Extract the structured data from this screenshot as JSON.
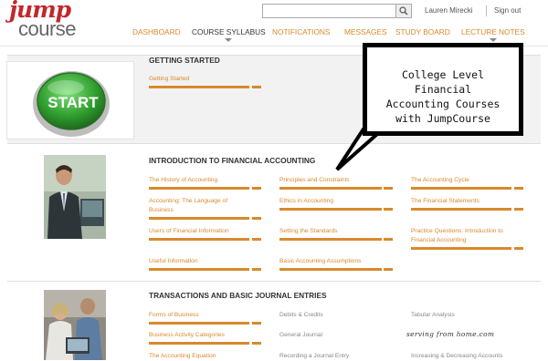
{
  "logo": {
    "line1": "jump",
    "line2": "course"
  },
  "search": {
    "placeholder": ""
  },
  "user": {
    "name": "Lauren Mirecki",
    "signout": "Sign out"
  },
  "nav": [
    "DASHBOARD",
    "COURSE SYLLABUS",
    "NOTIFICATIONS",
    "MESSAGES",
    "STUDY BOARD",
    "LECTURE NOTES"
  ],
  "sections": [
    {
      "title": "GETTING STARTED",
      "image_label": "START",
      "links": [
        "Getting Started"
      ]
    },
    {
      "title": "INTRODUCTION TO FINANCIAL ACCOUNTING",
      "links": [
        "The History of Accounting",
        "Principles and Constraints",
        "The Accounting Cycle",
        "Accounting: The Language of Business",
        "Ethics in Accounting",
        "The Financial Statements",
        "Users of Financial Information",
        "Setting the Standards",
        "Practice Questions: Introduction to Financial Accounting",
        "Useful Information",
        "Basic Accounting Assumptions"
      ]
    },
    {
      "title": "TRANSACTIONS AND BASIC JOURNAL ENTRIES",
      "links": [
        "Forms of Business",
        "Debits & Credits",
        "Tabular Analysis",
        "Business Activity Categories",
        "General Journal",
        "The Accounting Equation",
        "Recording a Journal Entry",
        "Increasing & Decreasing Accounts"
      ]
    }
  ],
  "callout": {
    "lines": [
      "College Level",
      "Financial",
      "Accounting Courses",
      "with JumpCourse"
    ]
  },
  "watermark": "serving from home.com",
  "colors": {
    "accent": "#d8892d",
    "logo_red": "#c1272d",
    "text_dark": "#333333"
  }
}
